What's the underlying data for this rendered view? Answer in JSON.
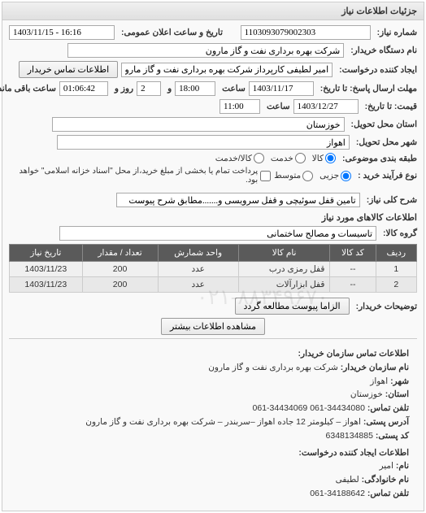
{
  "panel": {
    "title": "جزئیات اطلاعات نیاز"
  },
  "fields": {
    "number_label": "شماره نیاز:",
    "number_value": "1103093079002303",
    "announce_label": "تاریخ و ساعت اعلان عمومی:",
    "announce_value": "1403/11/15 - 16:16",
    "buyer_label": "نام دستگاه خریدار:",
    "buyer_value": "شرکت بهره برداری نفت و گاز مارون",
    "requester_label": "ایجاد کننده درخواست:",
    "requester_value": "امیر لطیفی کارپرداز شرکت بهره برداری نفت و گاز مارون",
    "contact_btn": "اطلاعات تماس خریدار",
    "deadline_label": "مهلت ارسال پاسخ: تا تاریخ:",
    "deadline_date": "1403/11/17",
    "time_label1": "ساعت",
    "deadline_time": "18:00",
    "and_label": "و",
    "days_value": "2",
    "days_label": "روز و",
    "remaining_time": "01:06:42",
    "remaining_label": "ساعت باقی مانده",
    "price_until_label": "قیمت: تا تاریخ:",
    "price_date": "1403/12/27",
    "price_time": "11:00",
    "province_label": "استان محل تحویل:",
    "province_value": "خوزستان",
    "city_label": "شهر محل تحویل:",
    "city_value": "اهواز",
    "group_type_label": "طبقه بندی موضوعی:",
    "group_opt1": "کالا",
    "group_opt2": "خدمت",
    "group_opt3": "کالا/خدمت",
    "buy_type_label": "نوع فرآیند خرید :",
    "buy_opt1": "جزیی",
    "buy_opt2": "متوسط",
    "buy_note": "پرداخت تمام یا بخشی از مبلغ خرید،از محل \"اسناد خزانه اسلامی\" خواهد بود.",
    "desc_label": "شرح کلی نیاز:",
    "desc_value": "تامین قفل سوئیچی و قفل سرویسی و.......مطابق شرح پیوست",
    "items_title": "اطلاعات کالاهای مورد نیاز",
    "item_group_label": "گروه کالا:",
    "item_group_value": "تاسیسات و مصالح ساختمانی",
    "table": {
      "headers": [
        "ردیف",
        "کد کالا",
        "نام کالا",
        "واحد شمارش",
        "تعداد / مقدار",
        "تاریخ نیاز"
      ],
      "rows": [
        [
          "1",
          "--",
          "قفل رمزی درب",
          "عدد",
          "200",
          "1403/11/23"
        ],
        [
          "2",
          "--",
          "قفل ابزارآلات",
          "عدد",
          "200",
          "1403/11/23"
        ]
      ]
    },
    "buyer_notes_label": "توضیحات خریدار:",
    "attach_btn": "الزاما پیوست مطالعه گردد",
    "more_btn": "مشاهده اطلاعات بیشتر"
  },
  "contact": {
    "title": "اطلاعات تماس سازمان خریدار:",
    "org_label": "نام سازمان خریدار:",
    "org_value": "شرکت بهره برداری نفت و گاز مارون",
    "city_label": "شهر:",
    "city_value": "اهواز",
    "province_label": "استان:",
    "province_value": "خوزستان",
    "phone_label": "تلفن تماس:",
    "phone_value": "34434080-061   34434069-061",
    "address_label": "آدرس پستی:",
    "address_value": "اهواز – کیلومتر 12 جاده اهواز –سربندر – شرکت بهره برداری نفت و گاز مارون",
    "postal_label": "کد پستی:",
    "postal_value": "6348134885",
    "creator_title": "اطلاعات ایجاد کننده درخواست:",
    "name_label": "نام:",
    "name_value": "امیر",
    "surname_label": "نام خانوادگی:",
    "surname_value": "لطیفی",
    "cphone_label": "تلفن تماس:",
    "cphone_value": "34188642-061"
  },
  "watermark": "۰۲۱-۸۸۳۴۹۶۷۰"
}
